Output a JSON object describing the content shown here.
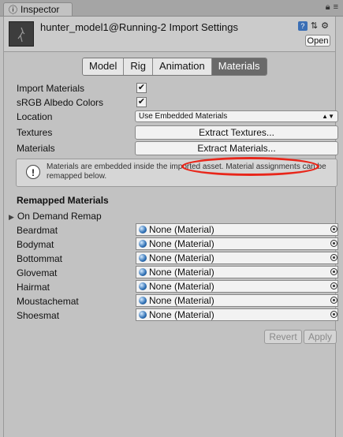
{
  "window": {
    "tab_label": "Inspector",
    "tab_icon": "info-icon",
    "tab_tools": [
      "lock-icon",
      "menu-icon"
    ]
  },
  "header": {
    "title": "hunter_model1@Running-2  Import Settings",
    "open_label": "Open",
    "icons": [
      "help-icon",
      "preset-icon",
      "settings-icon"
    ]
  },
  "tabs": [
    {
      "label": "Model",
      "active": false
    },
    {
      "label": "Rig",
      "active": false
    },
    {
      "label": "Animation",
      "active": false
    },
    {
      "label": "Materials",
      "active": true
    }
  ],
  "settings": {
    "import_materials_label": "Import Materials",
    "import_materials_checked": true,
    "srgb_label": "sRGB Albedo Colors",
    "srgb_checked": true,
    "location_label": "Location",
    "location_value": "Use Embedded Materials",
    "textures_label": "Textures",
    "extract_textures_label": "Extract Textures...",
    "materials_label": "Materials",
    "extract_materials_label": "Extract Materials..."
  },
  "info_message": "Materials are embedded inside the imported asset. Material assignments can be remapped below.",
  "remapped": {
    "section_title": "Remapped Materials",
    "foldout_label": "On Demand Remap",
    "items": [
      {
        "name": "Beardmat",
        "value": "None (Material)"
      },
      {
        "name": "Bodymat",
        "value": "None (Material)"
      },
      {
        "name": "Bottommat",
        "value": "None (Material)"
      },
      {
        "name": "Glovemat",
        "value": "None (Material)"
      },
      {
        "name": "Hairmat",
        "value": "None (Material)"
      },
      {
        "name": "Moustachemat",
        "value": "None (Material)"
      },
      {
        "name": "Shoesmat",
        "value": "None (Material)"
      }
    ]
  },
  "footer": {
    "revert_label": "Revert",
    "apply_label": "Apply"
  },
  "colors": {
    "active_tab": "#6a6a6a",
    "highlight": "#e8261a",
    "panel_bg": "#c2c2c2"
  }
}
